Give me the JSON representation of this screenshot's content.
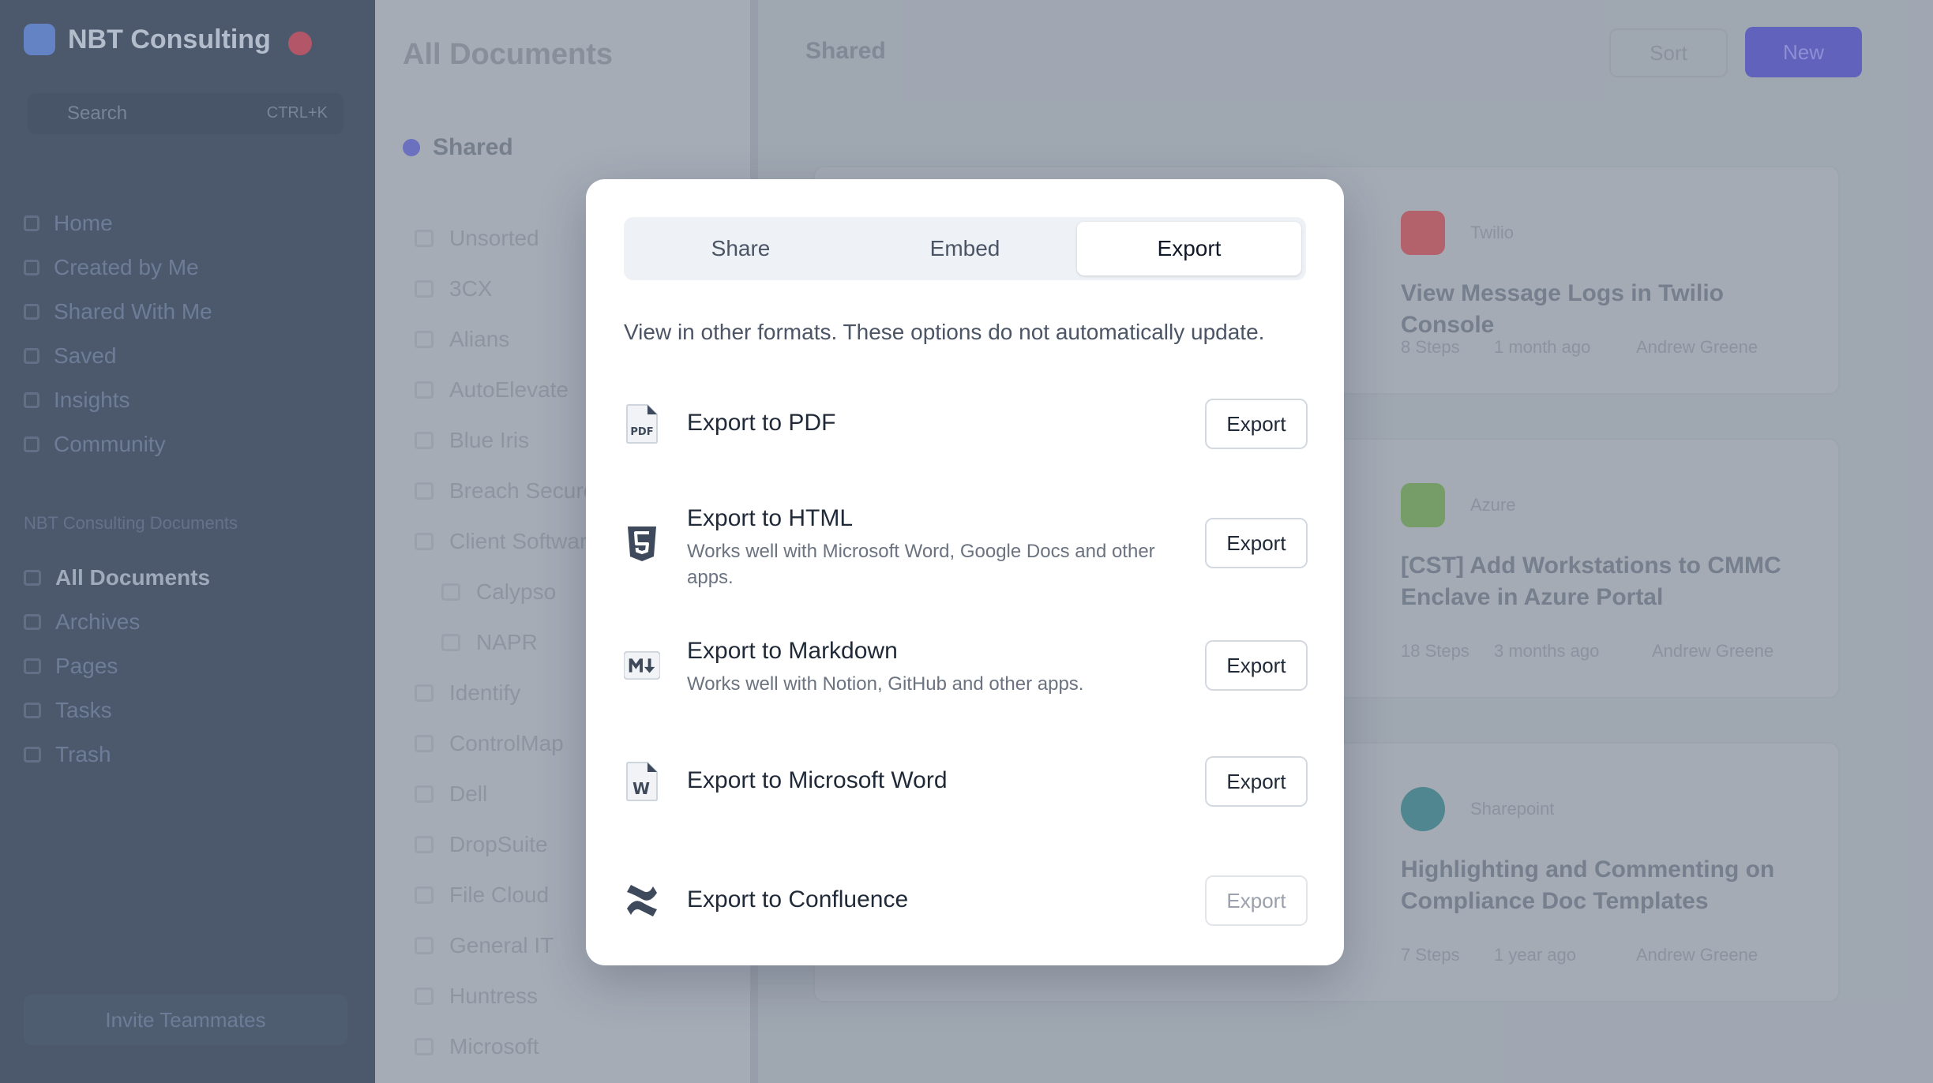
{
  "background": {
    "workspace_name": "NBT Consulting",
    "search_placeholder": "Search",
    "search_shortcut": "CTRL+K",
    "nav": [
      "Home",
      "Created by Me",
      "Shared With Me",
      "Saved",
      "Insights",
      "Community"
    ],
    "section_label": "NBT Consulting Documents",
    "nav2": [
      "All Documents",
      "Archives",
      "Pages",
      "Tasks",
      "Trash"
    ],
    "invite_label": "Invite Teammates",
    "doc_panel_title": "All Documents",
    "doc_group": "Shared",
    "doc_list": [
      "Unsorted",
      "3CX",
      "Alians",
      "AutoElevate",
      "Blue Iris",
      "Breach Secure",
      "Client Software",
      "Calypso",
      "NAPR",
      "Identify",
      "ControlMap",
      "Dell",
      "DropSuite",
      "File Cloud",
      "General IT",
      "Huntress",
      "Microsoft"
    ],
    "crumb": "Shared",
    "sort_label": "Sort",
    "new_label": "New",
    "cards": [
      {
        "app": "Twilio",
        "title": "View Message Logs in Twilio Console",
        "steps": "8 Steps",
        "time": "1 month ago",
        "author": "Andrew Greene"
      },
      {
        "app": "Azure",
        "title": "[CST] Add Workstations to CMMC Enclave in Azure Portal",
        "steps": "18 Steps",
        "time": "3 months ago",
        "author": "Andrew Greene"
      },
      {
        "app": "Sharepoint",
        "title": "Highlighting and Commenting on Compliance Doc Templates",
        "steps": "7 Steps",
        "time": "1 year ago",
        "author": "Andrew Greene"
      }
    ]
  },
  "modal": {
    "tabs": [
      "Share",
      "Embed",
      "Export"
    ],
    "active_tab": "Export",
    "description": "View in other formats. These options do not automatically update.",
    "options": [
      {
        "icon": "pdf-file-icon",
        "label": "Export to PDF",
        "sub": "",
        "button": "Export",
        "enabled": true
      },
      {
        "icon": "html5-icon",
        "label": "Export to HTML",
        "sub": "Works well with Microsoft Word, Google Docs and other apps.",
        "button": "Export",
        "enabled": true
      },
      {
        "icon": "markdown-icon",
        "label": "Export to Markdown",
        "sub": "Works well with Notion, GitHub and other apps.",
        "button": "Export",
        "enabled": true
      },
      {
        "icon": "word-file-icon",
        "label": "Export to Microsoft Word",
        "sub": "",
        "button": "Export",
        "enabled": true
      },
      {
        "icon": "confluence-icon",
        "label": "Export to Confluence",
        "sub": "",
        "button": "Export",
        "enabled": false
      }
    ]
  }
}
